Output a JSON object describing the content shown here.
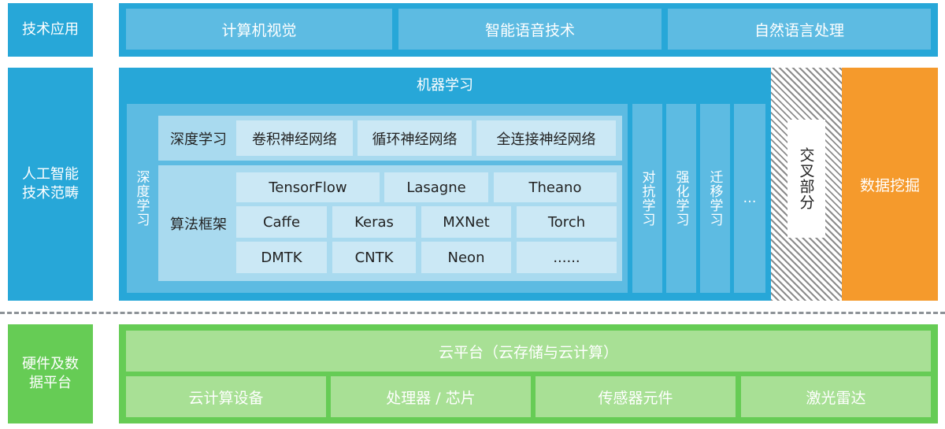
{
  "layers": {
    "application": {
      "label": "技术应用"
    },
    "category": {
      "label": "人工智能\n技术范畴"
    },
    "platform": {
      "label": "硬件及数\n据平台"
    }
  },
  "applications": [
    "计算机视觉",
    "智能语音技术",
    "自然语言处理"
  ],
  "machine_learning": {
    "title": "机器学习",
    "deep_learning": {
      "vertical_label": "深度学习",
      "networks": {
        "label": "深度学习",
        "items": [
          "卷积神经网络",
          "循环神经网络",
          "全连接神经网络"
        ]
      },
      "frameworks": {
        "label": "算法框架",
        "rows": [
          [
            "TensorFlow",
            "Lasagne",
            "Theano"
          ],
          [
            "Caffe",
            "Keras",
            "MXNet",
            "Torch"
          ],
          [
            "DMTK",
            "CNTK",
            "Neon",
            "......"
          ]
        ]
      }
    },
    "other_methods": [
      "对抗学习",
      "强化学习",
      "迁移学习",
      "…"
    ]
  },
  "cross_section": {
    "label": "交叉部分"
  },
  "data_mining": {
    "label": "数据挖掘"
  },
  "hardware": {
    "cloud_platform": "云平台（云存储与云计算）",
    "items": [
      "云计算设备",
      "处理器 / 芯片",
      "传感器元件",
      "激光雷达"
    ]
  },
  "colors": {
    "blue_dark": "#27a7d8",
    "blue_mid": "#5dbbe2",
    "blue_light": "#a9daef",
    "blue_chip": "#cbe8f5",
    "orange": "#f59a2c",
    "green_dark": "#66cc55",
    "green_light": "#a8e095",
    "dash_gray": "#8d9297"
  }
}
